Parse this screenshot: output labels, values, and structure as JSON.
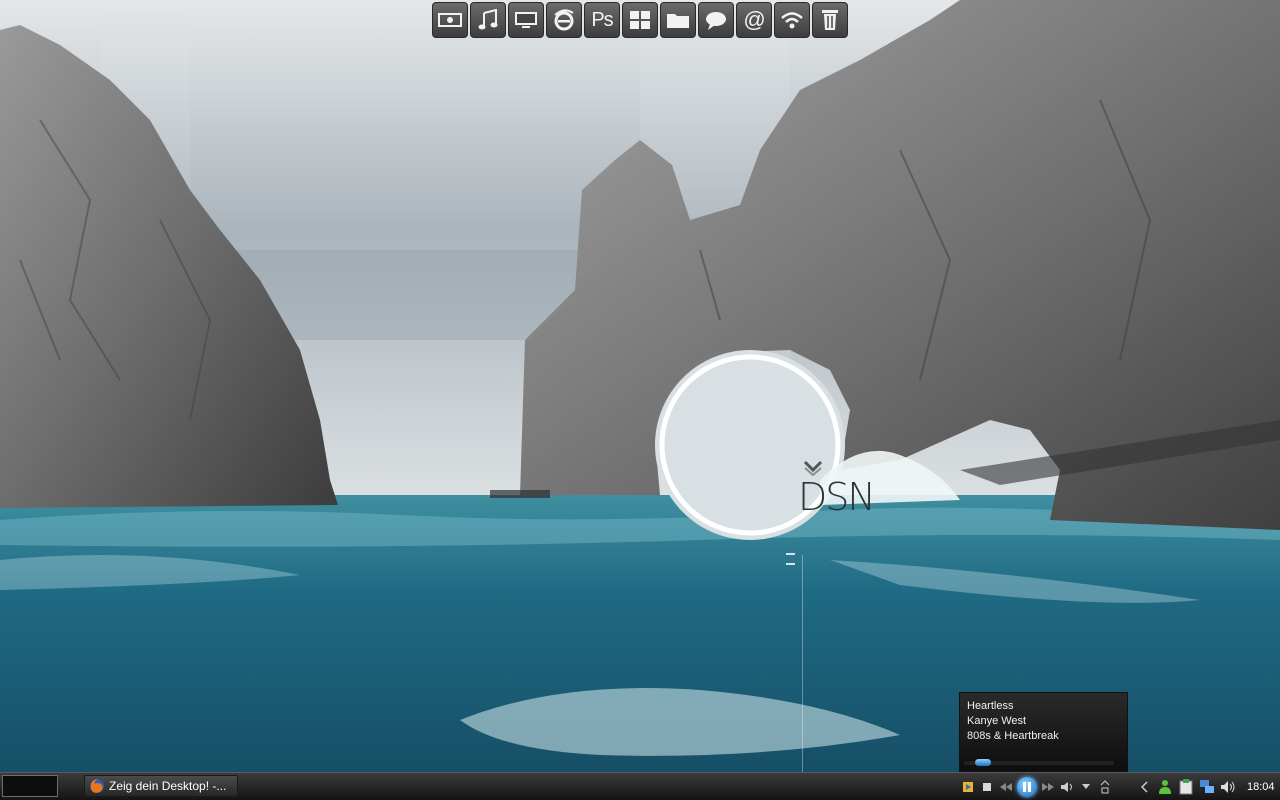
{
  "dock": {
    "items": [
      {
        "icon": "money-icon"
      },
      {
        "icon": "music-icon"
      },
      {
        "icon": "monitor-icon"
      },
      {
        "icon": "internet-explorer-icon"
      },
      {
        "icon": "photoshop-icon",
        "label": "Ps"
      },
      {
        "icon": "windows-icon"
      },
      {
        "icon": "folder-icon"
      },
      {
        "icon": "chat-icon"
      },
      {
        "icon": "email-icon",
        "label": "@"
      },
      {
        "icon": "wifi-icon"
      },
      {
        "icon": "trash-icon"
      }
    ]
  },
  "logo": {
    "text": "DSN"
  },
  "now_playing": {
    "title": "Heartless",
    "artist": "Kanye West",
    "album": "808s & Heartbreak",
    "progress": 0.07
  },
  "taskbar": {
    "task_label": "Zeig dein Desktop! -...",
    "clock": "18:04"
  },
  "colors": {
    "taskbar": "#1f1f1f",
    "accent": "#1c6fc4"
  }
}
